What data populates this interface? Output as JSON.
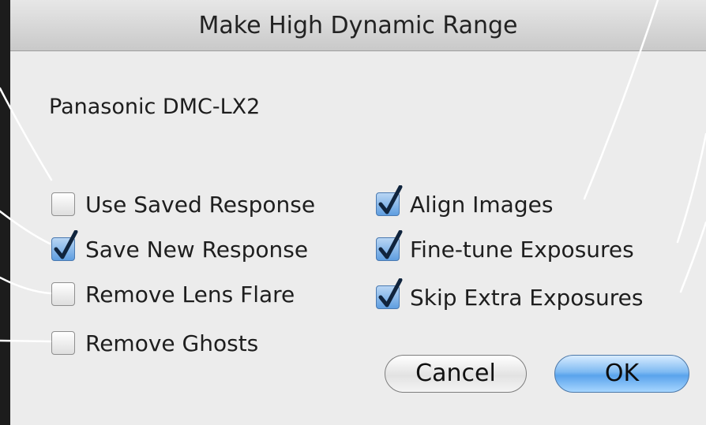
{
  "dialog": {
    "title": "Make High Dynamic Range",
    "camera": "Panasonic DMC-LX2"
  },
  "options_left": [
    {
      "label": "Use Saved Response",
      "checked": false
    },
    {
      "label": "Save New Response",
      "checked": true
    },
    {
      "label": "Remove Lens Flare",
      "checked": false
    },
    {
      "label": "Remove Ghosts",
      "checked": false
    }
  ],
  "options_right": [
    {
      "label": "Align Images",
      "checked": true
    },
    {
      "label": "Fine-tune Exposures",
      "checked": true
    },
    {
      "label": "Skip Extra Exposures",
      "checked": true
    }
  ],
  "buttons": {
    "cancel": "Cancel",
    "ok": "OK"
  },
  "colors": {
    "checkbox_checked": "#5f9ee0",
    "ok_button": "#7fbaf2",
    "callout_line": "#ffffff"
  }
}
